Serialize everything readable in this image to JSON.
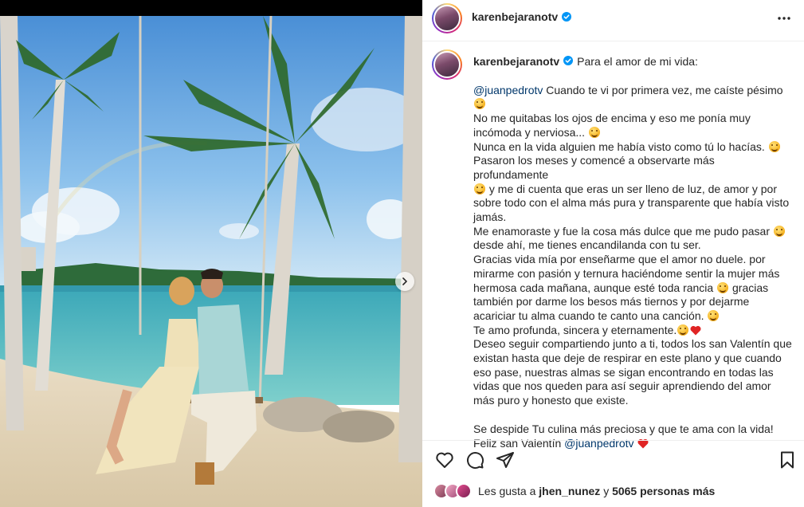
{
  "post": {
    "username": "karenbejaranotv",
    "verified": true,
    "more_icon": "ellipsis-icon"
  },
  "caption": {
    "first_line": "Para el amor de mi vida:",
    "mention": "@juanpedrotv",
    "lines": [
      "Cuando te vi por primera vez, me caíste pésimo",
      "No me quitabas los ojos de encima y eso me ponía muy incómoda y nerviosa...",
      "Nunca en la vida alguien me había visto como tú lo hacías.",
      "Pasaron los meses y comencé a observarte más profundamente",
      "y me di cuenta que eras un ser lleno de luz, de amor y por sobre todo con el alma más pura y transparente que había visto jamás.",
      "Me enamoraste y fue la cosa más dulce que me pudo pasar",
      "desde ahí, me tienes encandilanda con tu ser.",
      "Gracias vida mía por enseñarme que el amor no duele. por mirarme con pasión y ternura haciéndome sentir la mujer más hermosa cada mañana, aunque esté toda rancia",
      "gracias también por darme los besos más tiernos y por dejarme acariciar tu alma cuando te canto una canción.",
      "Te amo profunda, sincera y eternamente.",
      "Deseo seguir compartiendo junto a ti, todos los san Valentín que existan hasta que deje de respirar en este plano y que cuando eso pase, nuestras almas se sigan encontrando en todas las vidas que nos queden para así seguir aprendiendo del amor más puro y honesto que existe.",
      "Se despide Tu culina más preciosa y que te ama con la vida!",
      "Feliz san Valentín",
      "@juanpedrotv"
    ]
  },
  "actions": {
    "like_icon": "heart-icon",
    "comment_icon": "comment-icon",
    "share_icon": "paper-plane-icon",
    "save_icon": "bookmark-icon"
  },
  "likes": {
    "prefix": "Les gusta a",
    "user": "jhen_nunez",
    "connector": "y",
    "count": "5065 personas más"
  },
  "colors": {
    "link": "#00376b",
    "verified": "#0095f6",
    "heart": "#ed4956"
  }
}
